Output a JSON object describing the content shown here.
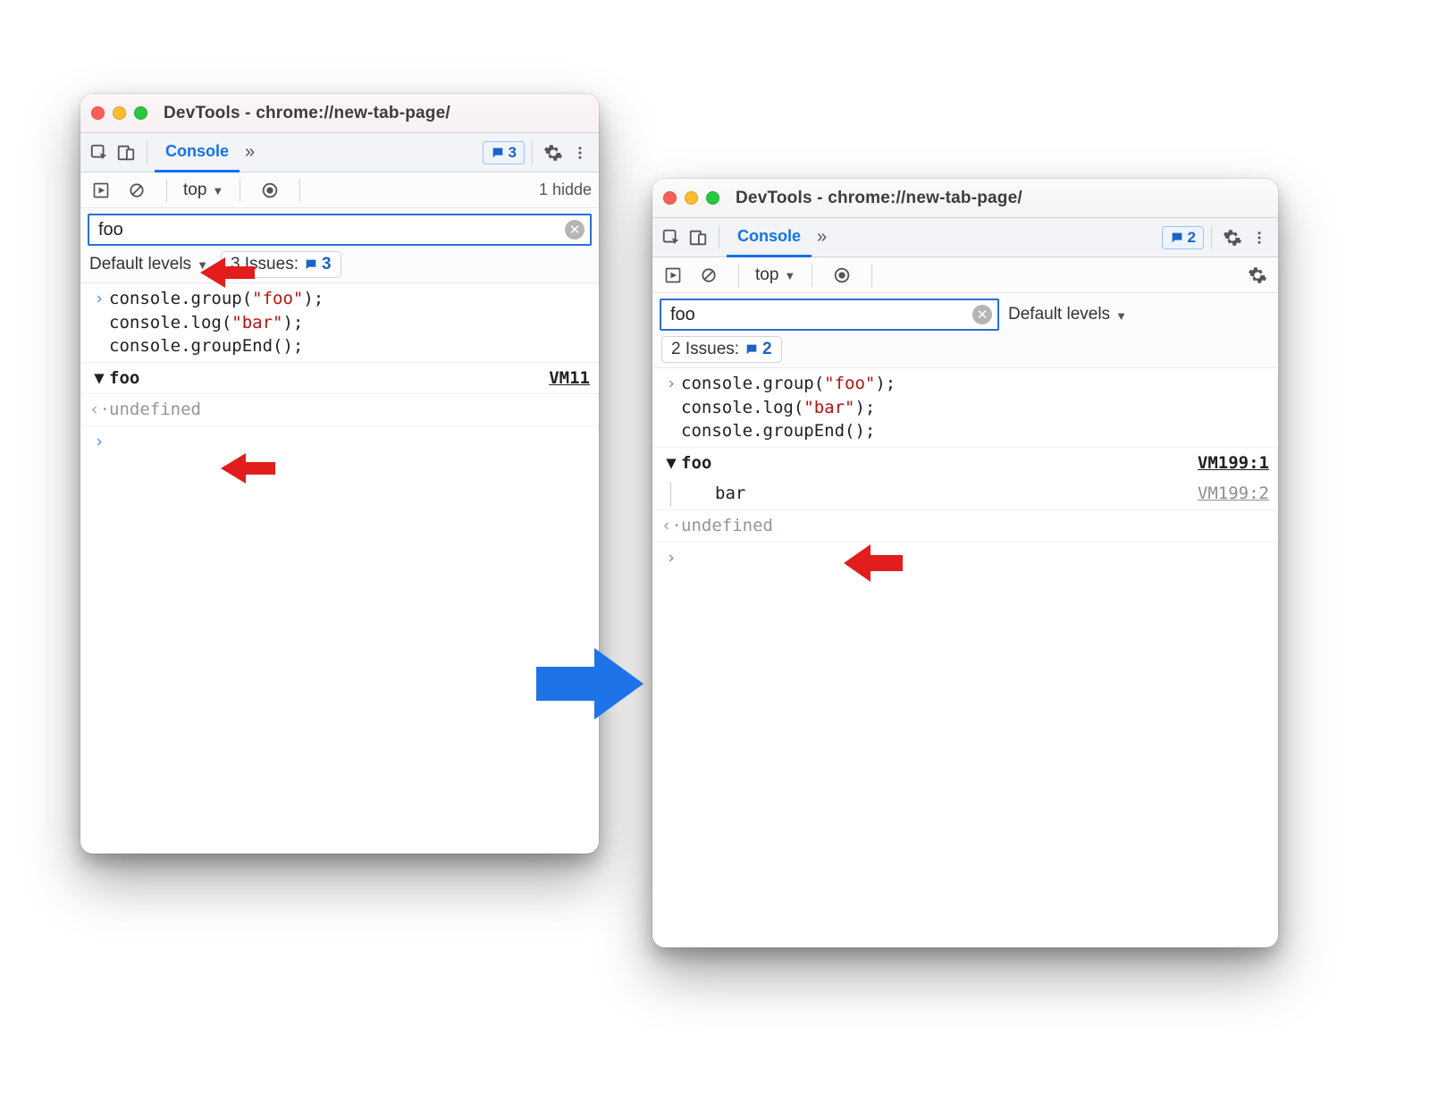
{
  "annotation": {
    "arrow_color": "#e11d1d",
    "big_arrow_color": "#1e73e8"
  },
  "window1": {
    "title": "DevTools - chrome://new-tab-page/",
    "tab": "Console",
    "toolbar_badge": "3",
    "context": "top",
    "hidden_text": "1 hidde",
    "filter_value": "foo",
    "levels_label": "Default levels",
    "issues_label": "3 Issues:",
    "issues_count": "3",
    "code": {
      "l1a": "console.group(",
      "l1b": "\"foo\"",
      "l1c": ");",
      "l2a": "console.log(",
      "l2b": "\"bar\"",
      "l2c": ");",
      "l3": "console.groupEnd();"
    },
    "group_label": "foo",
    "group_source": "VM11",
    "return_value": "undefined"
  },
  "window2": {
    "title": "DevTools - chrome://new-tab-page/",
    "tab": "Console",
    "toolbar_badge": "2",
    "context": "top",
    "filter_value": "foo",
    "levels_label": "Default levels",
    "issues_label": "2 Issues:",
    "issues_count": "2",
    "code": {
      "l1a": "console.group(",
      "l1b": "\"foo\"",
      "l1c": ");",
      "l2a": "console.log(",
      "l2b": "\"bar\"",
      "l2c": ");",
      "l3": "console.groupEnd();"
    },
    "group_label": "foo",
    "group_source": "VM199:1",
    "child_label": "bar",
    "child_source": "VM199:2",
    "return_value": "undefined"
  }
}
